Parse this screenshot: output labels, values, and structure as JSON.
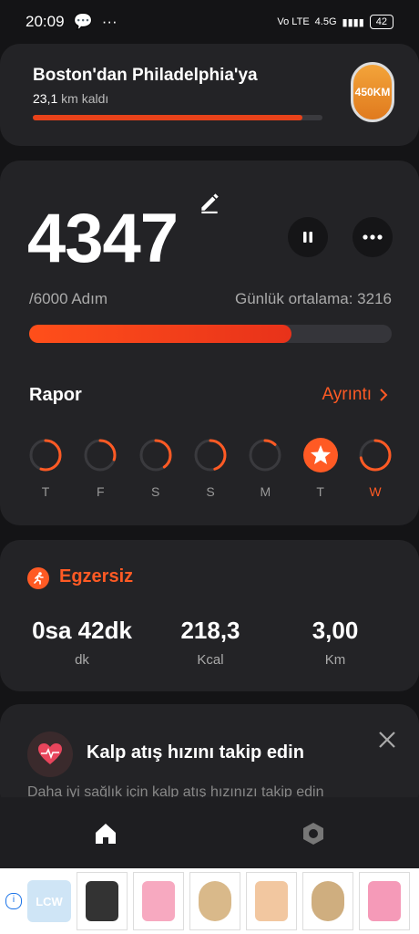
{
  "status_bar": {
    "time": "20:09",
    "network": "4.5G",
    "battery": "42",
    "volte": "Vo LTE"
  },
  "route_card": {
    "title": "Boston'dan Philadelphia'ya",
    "remaining_value": "23,1",
    "remaining_suffix": "km kaldı",
    "progress": 0.93,
    "medal_label": "450KM",
    "medal_icon": "medal-icon"
  },
  "steps_card": {
    "steps": "4347",
    "goal_text": "/6000 Adım",
    "daily_average": "Günlük ortalama: 3216",
    "progress": 0.7245,
    "report_label": "Rapor",
    "detail_label": "Ayrıntı",
    "days": [
      {
        "label": "T",
        "progress": 0.55,
        "today": false,
        "goal_reached": false
      },
      {
        "label": "F",
        "progress": 0.3,
        "today": false,
        "goal_reached": false
      },
      {
        "label": "S",
        "progress": 0.4,
        "today": false,
        "goal_reached": false
      },
      {
        "label": "S",
        "progress": 0.45,
        "today": false,
        "goal_reached": false
      },
      {
        "label": "M",
        "progress": 0.12,
        "today": false,
        "goal_reached": false
      },
      {
        "label": "T",
        "progress": 1.0,
        "today": false,
        "goal_reached": true
      },
      {
        "label": "W",
        "progress": 0.72,
        "today": true,
        "goal_reached": false
      }
    ],
    "accent_color": "#ff5a24"
  },
  "exercise_card": {
    "title": "Egzersiz",
    "stats": [
      {
        "value": "0sa 42dk",
        "unit": "dk"
      },
      {
        "value": "218,3",
        "unit": "Kcal"
      },
      {
        "value": "3,00",
        "unit": "Km"
      }
    ]
  },
  "heart_card": {
    "title": "Kalp atış hızını takip edin",
    "subtitle": "Daha iyi sağlık için kalp atış hızınızı takip edin"
  },
  "bottom_nav": {
    "items": [
      "home-icon",
      "settings-icon"
    ]
  },
  "ad": {
    "brand": "LCW",
    "info_icon": "i"
  }
}
